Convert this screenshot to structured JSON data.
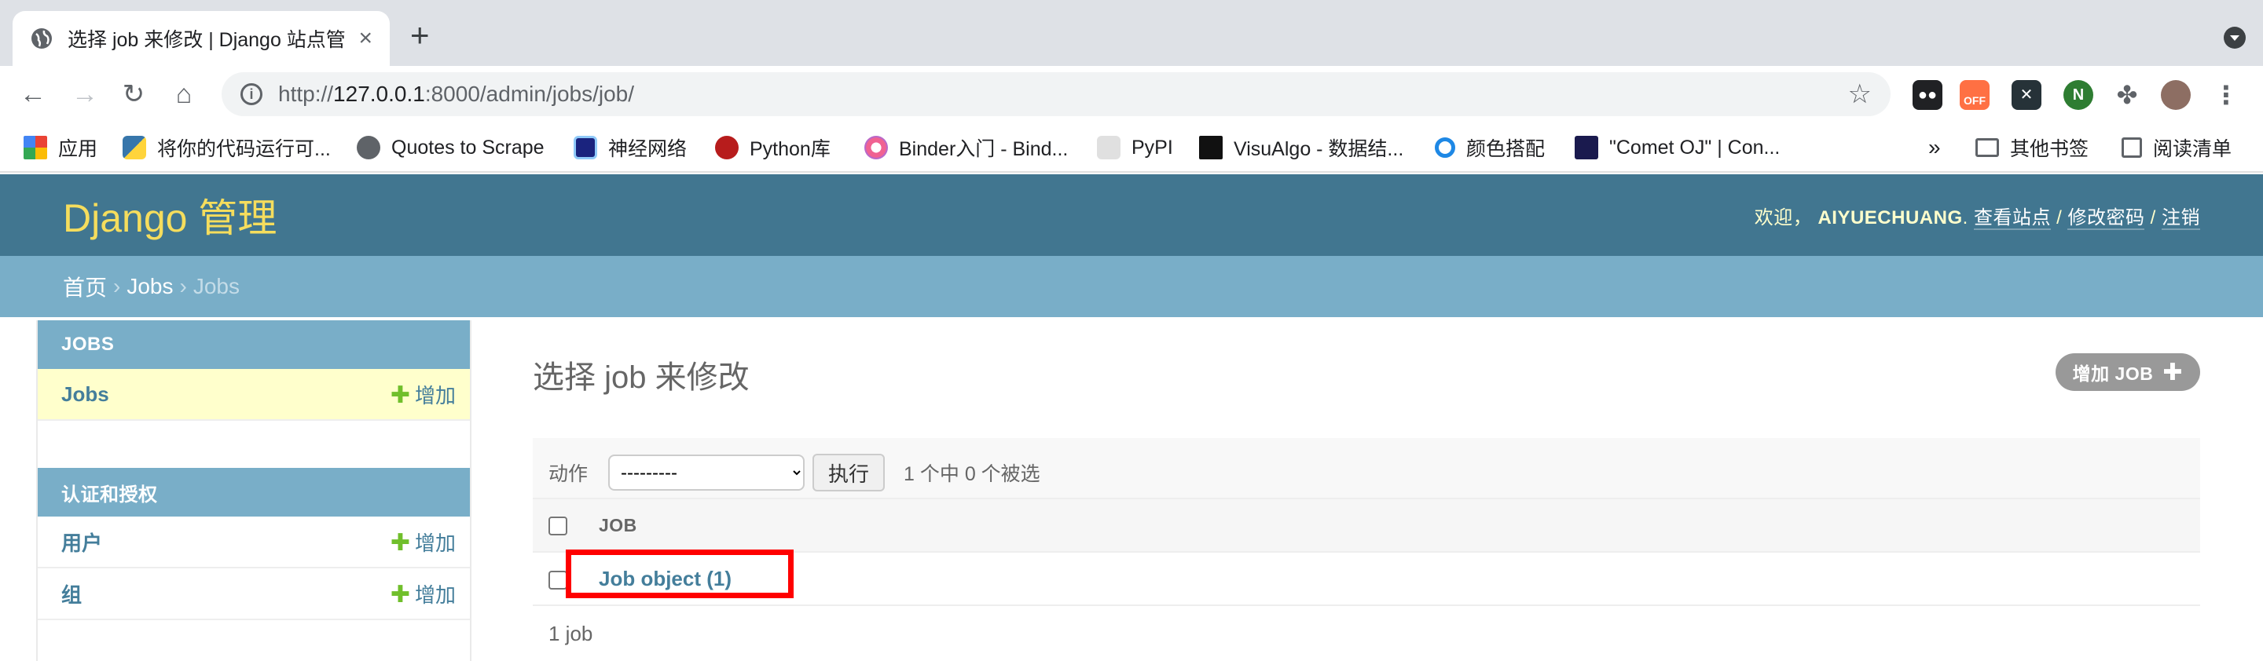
{
  "browser": {
    "tab_title": "选择 job 来修改 | Django 站点管",
    "url_prefix": "http://",
    "url_host": "127.0.0.1",
    "url_rest": ":8000/admin/jobs/job/",
    "extensions": {
      "off_badge": "OFF",
      "x_badge": "✕",
      "n_badge": "N"
    }
  },
  "bookmarks": [
    {
      "label": "应用",
      "color": "#4285f4"
    },
    {
      "label": "将你的代码运行可...",
      "color": "#3776ab"
    },
    {
      "label": "Quotes to Scrape",
      "color": "#5f6368"
    },
    {
      "label": "神经网络",
      "color": "#1a237e"
    },
    {
      "label": "Python库",
      "color": "#b71c1c"
    },
    {
      "label": "Binder入门 - Bind...",
      "color": "#f06292"
    },
    {
      "label": "PyPI",
      "color": "#cfcfcf"
    },
    {
      "label": "VisuAlgo - 数据结...",
      "color": "#111111"
    },
    {
      "label": "颜色搭配",
      "color": "#1e88e5"
    },
    {
      "label": "\"Comet OJ\" | Con...",
      "color": "#1a1a4e"
    }
  ],
  "bookmarks_overflow": "»",
  "bookmarks_other": "其他书签",
  "bookmarks_reading": "阅读清单",
  "header": {
    "branding": "Django 管理",
    "welcome": "欢迎，",
    "username": "AIYUECHUANG",
    "view_site": "查看站点",
    "change_password": "修改密码",
    "logout": "注销",
    "sep": " / "
  },
  "breadcrumbs": {
    "home": "首页",
    "app": "Jobs",
    "current": "Jobs",
    "sep": "›"
  },
  "sidebar": {
    "modules": [
      {
        "caption": "JOBS",
        "rows": [
          {
            "model": "Jobs",
            "add": "增加",
            "current": true
          }
        ]
      },
      {
        "caption": "认证和授权",
        "rows": [
          {
            "model": "用户",
            "add": "增加"
          },
          {
            "model": "组",
            "add": "增加"
          }
        ]
      }
    ],
    "plus": "✚"
  },
  "main": {
    "title": "选择 job 来修改",
    "add_button": "增加 JOB",
    "add_plus": "✚",
    "actions_label": "动作",
    "action_select_value": "---------",
    "go_button": "执行",
    "selection_counter": "1 个中 0 个被选",
    "column_header": "JOB",
    "rows": [
      {
        "object": "Job object (1)"
      }
    ],
    "paginator": "1 job"
  }
}
